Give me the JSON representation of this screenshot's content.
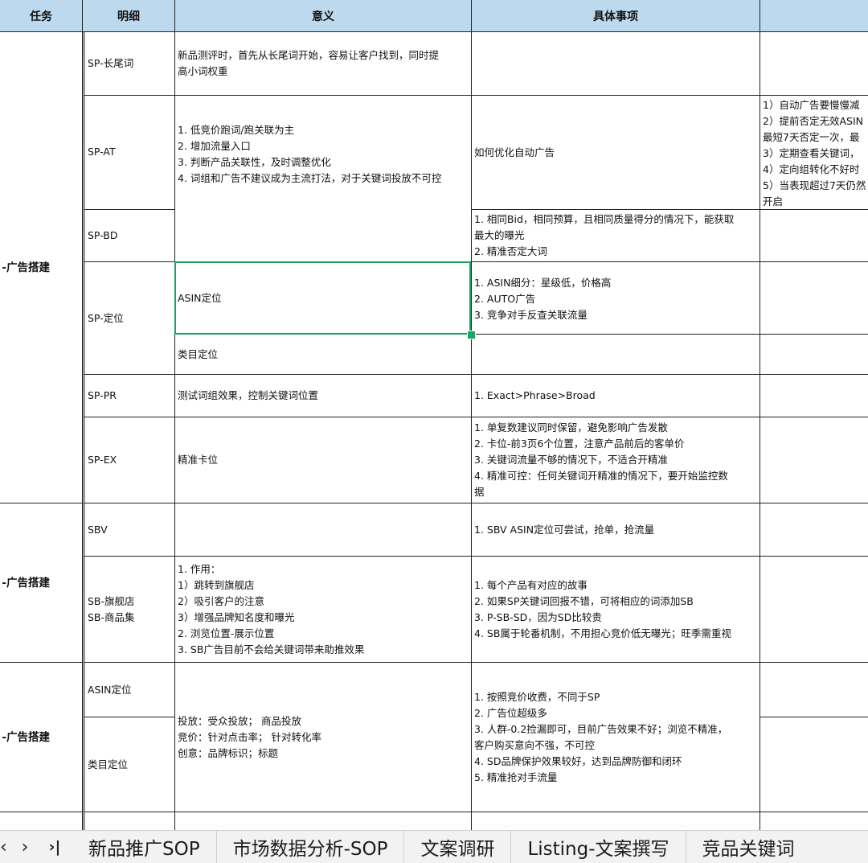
{
  "headers": {
    "task": "任务",
    "detail": "明细",
    "meaning": "意义",
    "items": "具体事项"
  },
  "tasks": [
    {
      "label": "-广告搭建"
    },
    {
      "label": "-广告搭建"
    },
    {
      "label": "-广告搭建"
    }
  ],
  "rows": {
    "sp_long": {
      "detail": "SP-长尾词",
      "meaning": "新品测评时，首先从长尾词开始，容易让客户找到，同时提\n高小词权重",
      "items": "",
      "extra": ""
    },
    "sp_at": {
      "detail": "SP-AT",
      "items": "如何优化自动广告",
      "extra": "1）自动广告要慢慢减\n2）提前否定无效ASIN\n最短7天否定一次，最\n3）定期查看关键词，\n4）定向组转化不好时\n5）当表现超过7天仍然\n开启"
    },
    "sp_at_bd_meaning": "1. 低竞价跑词/跑关联为主\n2. 增加流量入口\n3. 判断产品关联性，及时调整优化\n4. 词组和广告不建议成为主流打法，对于关键词投放不可控",
    "sp_bd": {
      "detail": "SP-BD",
      "items": "1. 相同Bid，相同预算，且相同质量得分的情况下，能获取\n最大的曝光\n2. 精准否定大词",
      "extra": ""
    },
    "sp_target": {
      "detail": "SP-定位"
    },
    "sp_target_asin": {
      "meaning": "ASIN定位",
      "items": "1. ASIN细分：星级低，价格高\n2. AUTO广告\n3. 竞争对手反查关联流量",
      "extra": ""
    },
    "sp_target_cat": {
      "meaning": "类目定位",
      "items": "",
      "extra": ""
    },
    "sp_pr": {
      "detail": "SP-PR",
      "meaning": "测试词组效果，控制关键词位置",
      "items": "1. Exact>Phrase>Broad",
      "extra": ""
    },
    "sp_ex": {
      "detail": "SP-EX",
      "meaning": "精准卡位",
      "items": "1. 单复数建议同时保留，避免影响广告发散\n2. 卡位-前3页6个位置，注意产品前后的客单价\n3. 关键词流量不够的情况下，不适合开精准\n4. 精准可控：任何关键词开精准的情况下，要开始监控数\n据",
      "extra": ""
    },
    "sbv": {
      "detail": "SBV",
      "meaning": "",
      "items": "1. SBV ASIN定位可尝试，抢单，抢流量",
      "extra": ""
    },
    "sb_store": {
      "detail": "SB-旗舰店\nSB-商品集",
      "meaning": "1. 作用：\n1）跳转到旗舰店\n2）吸引客户的注意\n3）增强品牌知名度和曝光\n2. 浏览位置-展示位置\n3. SB广告目前不会给关键词带来助推效果",
      "items": "1. 每个产品有对应的故事\n2. 如果SP关键词回报不错，可将相应的词添加SB\n3. P-SB-SD，因为SD比较贵\n4. SB属于轮番机制，不用担心竞价低无曝光；旺季需重视",
      "extra": ""
    },
    "sd_asin": {
      "detail": "ASIN定位",
      "extra": ""
    },
    "sd_cat": {
      "detail": "类目定位",
      "extra": ""
    },
    "sd_meaning": "投放：受众投放； 商品投放\n竞价：针对点击率； 针对转化率\n创意：品牌标识；标题",
    "sd_items": "1. 按照竞价收费，不同于SP\n2. 广告位超级多\n3. 人群-0.2捡漏即可，目前广告效果不好；浏览不精准，\n客户购买意向不强，不可控\n4. SD品牌保护效果较好，达到品牌防御和闭环\n5. 精准抢对手流量"
  },
  "sheet_tabs": [
    "新品推广SOP",
    "市场数据分析-SOP",
    "文案调研",
    "Listing-文案撰写",
    "竞品关键词"
  ],
  "nav": {
    "first": "‹",
    "next": "›",
    "last": "›|"
  },
  "colors": {
    "header_bg": "#bcd9ee",
    "selection": "#1aa260",
    "grid": "#222222"
  }
}
